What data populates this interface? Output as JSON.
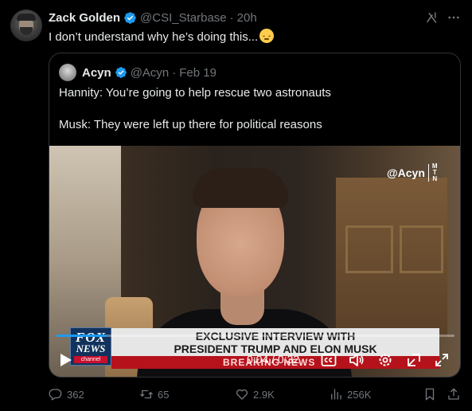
{
  "tweet": {
    "author_name": "Zack Golden",
    "author_handle": "@CSI_Starbase",
    "separator": "·",
    "time": "20h",
    "text": "I don’t understand why he’s doing this..."
  },
  "quote": {
    "author_name": "Acyn",
    "author_handle": "@Acyn",
    "separator": "·",
    "date": "Feb 19",
    "lines": [
      "Hannity: You’re going to help rescue two astronauts",
      "Musk: They were left up there for political reasons"
    ],
    "video": {
      "watermark": "@Acyn",
      "watermark_mtn": [
        "M",
        "T",
        "N"
      ],
      "fox_logo": {
        "fox": "FOX",
        "news": "NEWS",
        "channel": "channel"
      },
      "chyron_line1": "EXCLUSIVE INTERVIEW WITH",
      "chyron_line2": "PRESIDENT TRUMP AND ELON MUSK",
      "breaking_text": "BREAKING NEWS",
      "timecode": "0:04 / 0:32",
      "progress": 0.125
    }
  },
  "actions": {
    "replies": "362",
    "reposts": "65",
    "likes": "2.9K",
    "views": "256K"
  },
  "colors": {
    "background": "#000000",
    "text_primary": "#e7e9ea",
    "text_secondary": "#71767b",
    "accent": "#1d9bf0",
    "border": "#2f3336"
  }
}
